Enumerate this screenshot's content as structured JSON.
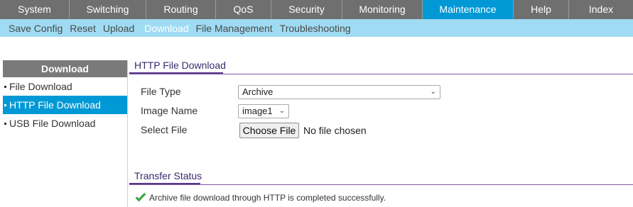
{
  "top_nav": [
    {
      "label": "System"
    },
    {
      "label": "Switching"
    },
    {
      "label": "Routing"
    },
    {
      "label": "QoS"
    },
    {
      "label": "Security"
    },
    {
      "label": "Monitoring"
    },
    {
      "label": "Maintenance",
      "active": true
    },
    {
      "label": "Help"
    },
    {
      "label": "Index"
    }
  ],
  "sub_nav": [
    {
      "label": "Save Config"
    },
    {
      "label": "Reset"
    },
    {
      "label": "Upload"
    },
    {
      "label": "Download",
      "active": true
    },
    {
      "label": "File Management"
    },
    {
      "label": "Troubleshooting"
    }
  ],
  "sidebar": {
    "title": "Download",
    "items": [
      {
        "label": "File Download"
      },
      {
        "label": "HTTP File Download",
        "active": true
      },
      {
        "label": "USB File Download"
      }
    ]
  },
  "http_section": {
    "title": "HTTP File Download",
    "file_type_label": "File Type",
    "file_type_value": "Archive",
    "image_name_label": "Image Name",
    "image_name_value": "image1",
    "select_file_label": "Select File",
    "choose_file_button": "Choose File",
    "no_file_text": "No file chosen"
  },
  "transfer_section": {
    "title": "Transfer Status",
    "status_icon": "checkmark-icon",
    "status_message": "Archive file download through HTTP is completed successfully."
  },
  "colors": {
    "accent": "#0099d6",
    "nav_bg": "#6f6f6f",
    "subnav_bg": "#9fdcf3",
    "section_title": "#3a2a6e",
    "success": "#3cb043"
  }
}
